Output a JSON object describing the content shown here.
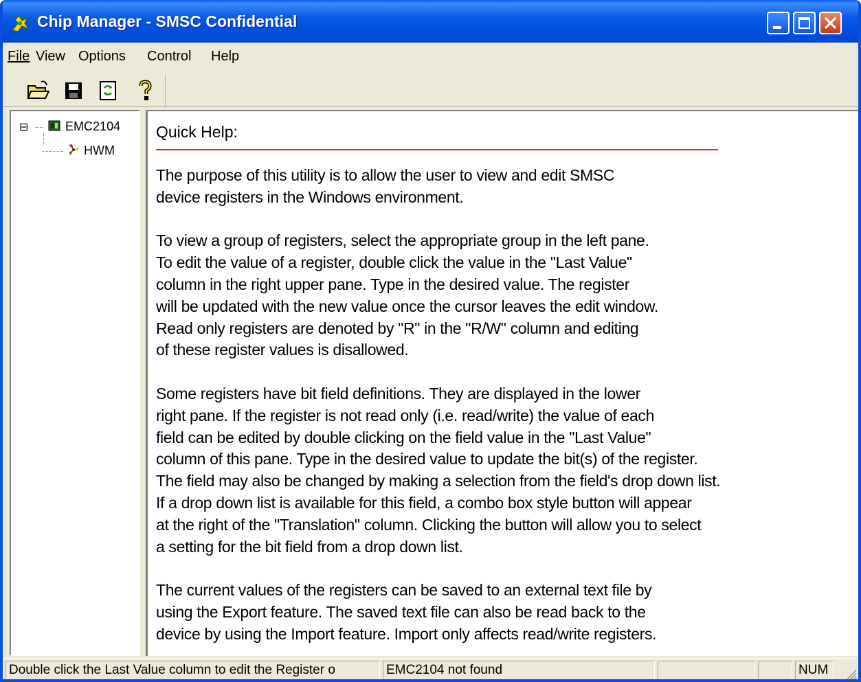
{
  "window": {
    "title": "Chip Manager - SMSC Confidential",
    "title_bar_color": "#0a5ae6",
    "icons": {
      "app": "chip-manager-icon",
      "minimize": "minimize-icon",
      "maximize": "maximize-icon",
      "close": "close-icon"
    }
  },
  "menu": {
    "items": [
      {
        "label": "File",
        "underline": "F"
      },
      {
        "label": "View",
        "underline": "V"
      },
      {
        "label": "Options",
        "underline": "O"
      },
      {
        "label": "Control",
        "underline": "C"
      },
      {
        "label": "Help",
        "underline": "H"
      }
    ]
  },
  "toolbar": {
    "buttons": [
      {
        "icon": "open-folder-icon"
      },
      {
        "icon": "save-disk-icon"
      },
      {
        "icon": "refresh-icon"
      },
      {
        "icon": "help-question-icon"
      }
    ]
  },
  "tree": {
    "root": {
      "label": "EMC2104",
      "icon": "chip-icon",
      "expander": "⊟"
    },
    "children": [
      {
        "label": "HWM",
        "icon": "fan-icon"
      }
    ]
  },
  "help": {
    "title": "Quick Help:",
    "rule_color": "#e23030",
    "body": "The purpose of this utility is to allow the user to view and edit SMSC\ndevice registers in the Windows environment.\n\nTo view a group of registers, select the appropriate group in the left pane.\nTo edit the value of a register, double click the value in the \"Last Value\"\ncolumn in the right upper pane. Type in the desired value. The register\nwill be updated with the new value once the cursor leaves the edit window.\nRead only registers are denoted by \"R\" in the \"R/W\" column and editing\nof these register values is disallowed.\n\nSome registers have bit field definitions. They are displayed in the lower\nright pane. If the register is not read only (i.e. read/write) the value of each\nfield can be edited by double clicking on the field value in the \"Last Value\"\ncolumn of this pane. Type in the desired value to update the bit(s) of the register.\nThe field may also be changed by making a selection from the field's drop down list.\nIf a drop down list is available for this field, a combo box style button will appear\nat the right of the \"Translation\" column.  Clicking the button will allow you to select\na setting for the bit field from a drop down list.\n\nThe current values of the registers can be saved to an external text file by\nusing the Export feature. The saved text file can also be read back to the\ndevice by using the Import feature. Import only affects read/write registers."
  },
  "statusbar": {
    "hint": "Double click the Last Value column to edit the Register o",
    "device_status": "EMC2104 not found",
    "empty1": "",
    "empty2": "",
    "num": "NUM"
  }
}
